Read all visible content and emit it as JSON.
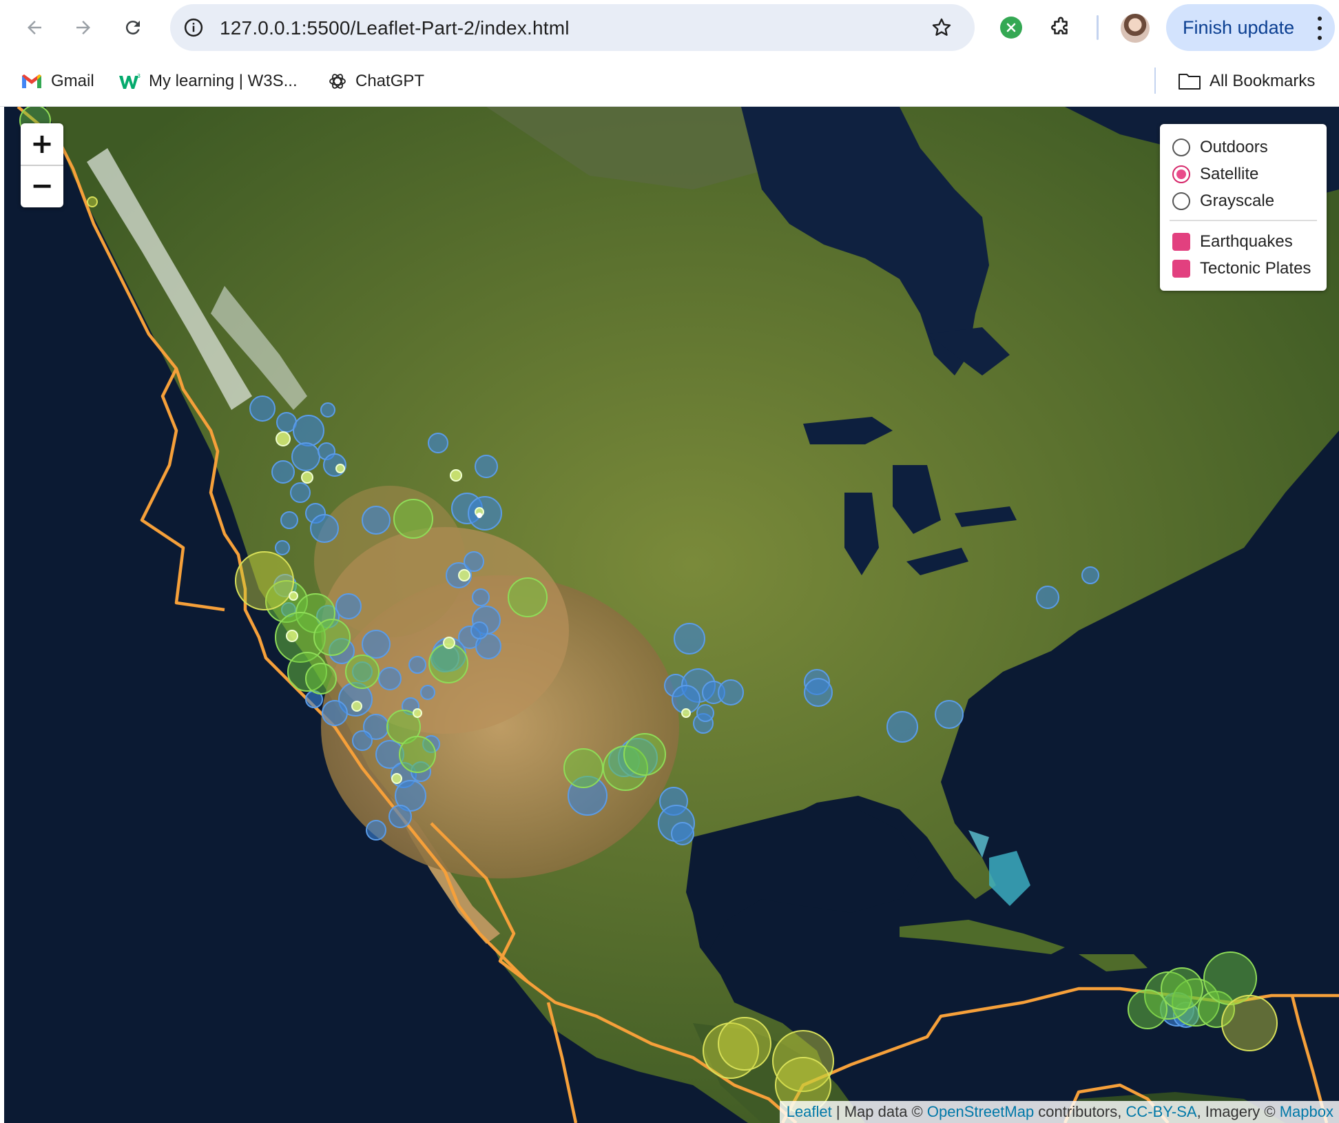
{
  "browser": {
    "url": "127.0.0.1:5500/Leaflet-Part-2/index.html",
    "finish_update_label": "Finish update"
  },
  "bookmarks": {
    "items": [
      {
        "label": "Gmail",
        "icon": "gmail-icon"
      },
      {
        "label": "My learning | W3S...",
        "icon": "w3schools-icon"
      },
      {
        "label": "ChatGPT",
        "icon": "chatgpt-icon"
      }
    ],
    "all_bookmarks_label": "All Bookmarks"
  },
  "map": {
    "zoom_in_label": "+",
    "zoom_out_label": "−",
    "base_layers": [
      {
        "label": "Outdoors",
        "selected": false
      },
      {
        "label": "Satellite",
        "selected": true
      },
      {
        "label": "Grayscale",
        "selected": false
      }
    ],
    "overlays": [
      {
        "label": "Earthquakes",
        "checked": true
      },
      {
        "label": "Tectonic Plates",
        "checked": true
      }
    ],
    "attribution": {
      "leaflet": "Leaflet",
      "separator": " | Map data © ",
      "osm": "OpenStreetMap",
      "contributors": " contributors, ",
      "license": "CC-BY-SA",
      "imagery": ", Imagery © ",
      "provider": "Mapbox"
    },
    "colors": {
      "plate_line": "#f6a03a",
      "shallow_quake": "#3b82d6",
      "mid_quake": "#6cc43c",
      "deep_quake": "#c8d13c",
      "accent": "#e2407f"
    }
  }
}
